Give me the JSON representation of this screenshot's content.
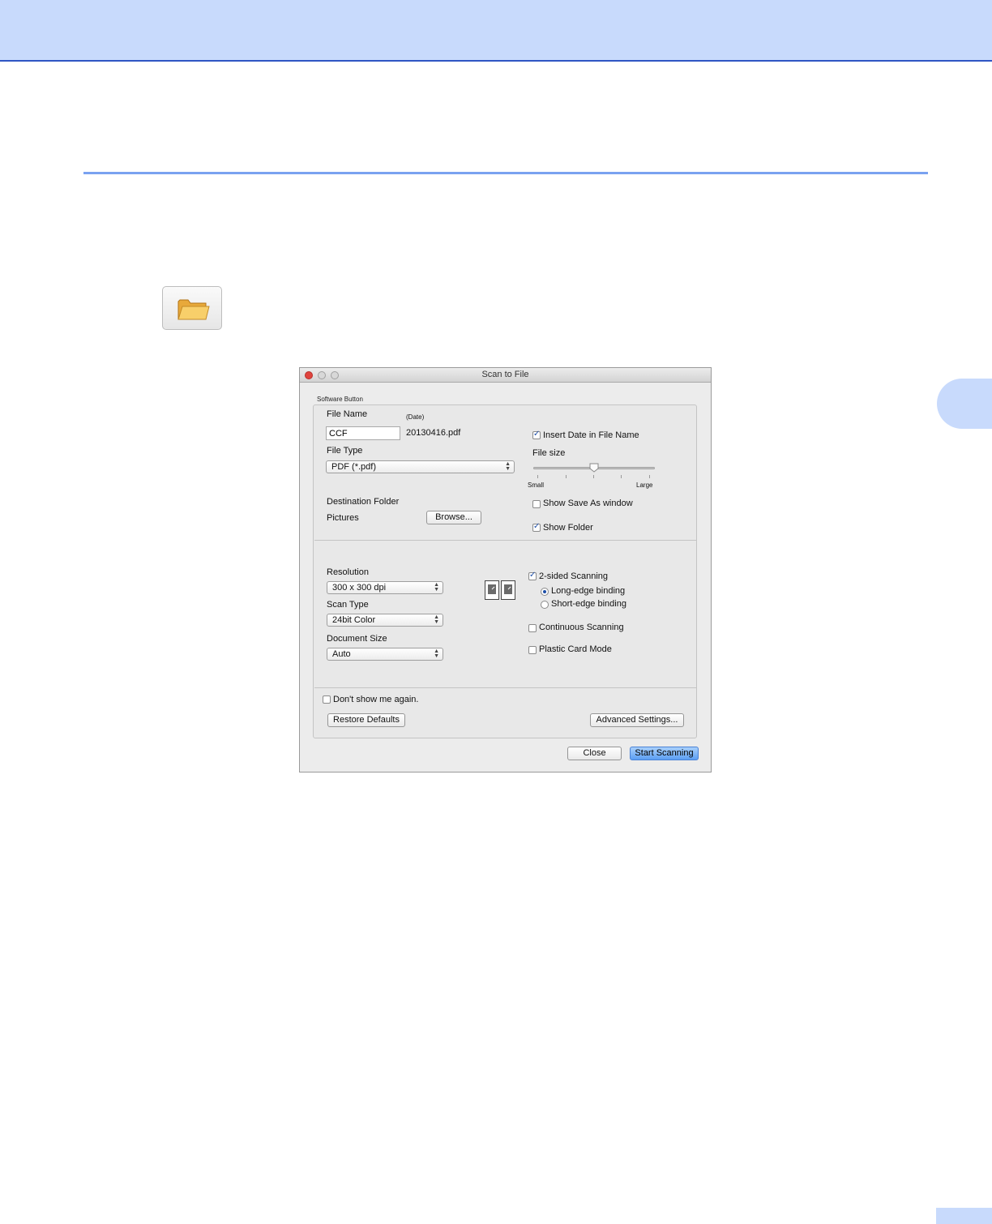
{
  "dialog": {
    "title": "Scan to File",
    "group_label": "Software Button",
    "file_name_label": "File Name",
    "date_label": "(Date)",
    "file_name_value": "CCF",
    "date_file_suffix": "20130416.pdf",
    "insert_date_label": "Insert Date in File Name",
    "insert_date_checked": true,
    "file_type_label": "File Type",
    "file_type_value": "PDF (*.pdf)",
    "file_size_label": "File size",
    "file_size_small": "Small",
    "file_size_large": "Large",
    "file_size_level": 0.5,
    "destination_label": "Destination Folder",
    "destination_value": "Pictures",
    "browse_label": "Browse...",
    "show_save_as_label": "Show Save As window",
    "show_save_as_checked": false,
    "show_folder_label": "Show Folder",
    "show_folder_checked": true,
    "resolution_label": "Resolution",
    "resolution_value": "300 x 300 dpi",
    "scan_type_label": "Scan Type",
    "scan_type_value": "24bit Color",
    "document_size_label": "Document Size",
    "document_size_value": "Auto",
    "two_sided_label": "2-sided Scanning",
    "two_sided_checked": true,
    "long_edge_label": "Long-edge binding",
    "long_edge_selected": true,
    "short_edge_label": "Short-edge binding",
    "continuous_label": "Continuous Scanning",
    "continuous_checked": false,
    "plastic_card_label": "Plastic Card Mode",
    "plastic_card_checked": false,
    "dont_show_label": "Don't show me again.",
    "dont_show_checked": false,
    "restore_defaults_label": "Restore Defaults",
    "advanced_settings_label": "Advanced Settings...",
    "close_label": "Close",
    "start_scanning_label": "Start Scanning"
  },
  "icons": {
    "folder_button": "folder-icon",
    "duplex": "two-sided-scan-icon"
  },
  "colors": {
    "banner": "#c8dafc",
    "accent_rule": "#7aa2f0",
    "primary_button": "#5b9ef3"
  }
}
